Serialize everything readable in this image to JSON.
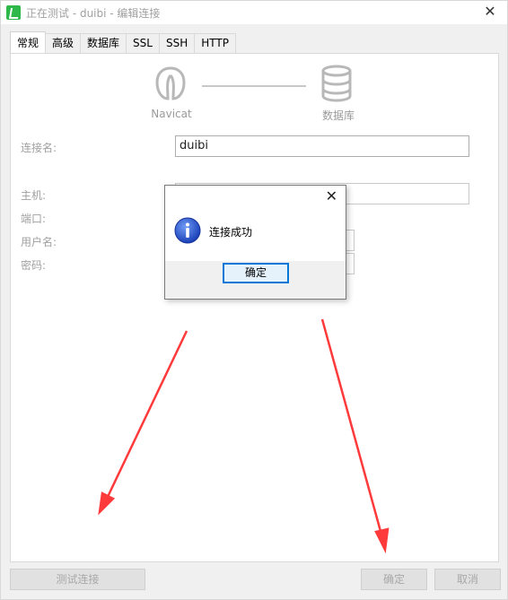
{
  "window": {
    "title": "正在测试 - duibi - 编辑连接"
  },
  "tabs": [
    {
      "label": "常规",
      "active": true
    },
    {
      "label": "高级"
    },
    {
      "label": "数据库"
    },
    {
      "label": "SSL"
    },
    {
      "label": "SSH"
    },
    {
      "label": "HTTP"
    }
  ],
  "logos": {
    "left_label": "Navicat",
    "right_label": "数据库"
  },
  "form": {
    "connection_name_label": "连接名:",
    "connection_name_value": "duibi",
    "host_label": "主机:",
    "port_label": "端口:",
    "username_label": "用户名:",
    "password_label": "密码:"
  },
  "buttons": {
    "test_connection": "测试连接",
    "ok": "确定",
    "cancel": "取消"
  },
  "dialog": {
    "message": "连接成功",
    "ok_label": "确定",
    "icon": "info-icon"
  },
  "colors": {
    "accent": "#0078d7",
    "info_blue": "#1f4fc8",
    "arrow_red": "#ff3a3a"
  }
}
